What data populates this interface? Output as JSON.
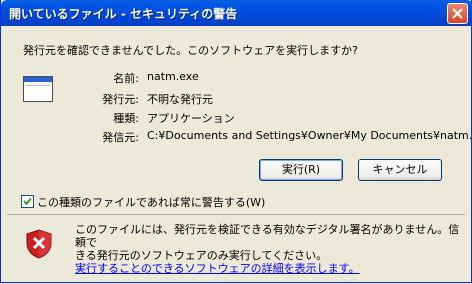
{
  "window": {
    "title": "開いているファイル - セキュリティの警告"
  },
  "dialog": {
    "prompt": "発行元を確認できませんでした。このソフトウェアを実行しますか?",
    "fields": [
      {
        "label": "名前:",
        "value": "natm.exe"
      },
      {
        "label": "発行元:",
        "value": "不明な発行元"
      },
      {
        "label": "種類:",
        "value": "アプリケーション"
      },
      {
        "label": "発信元:",
        "value": "C:¥Documents and Settings¥Owner¥My Documents¥natm.."
      }
    ],
    "run_button": "実行(R)",
    "cancel_button": "キャンセル",
    "checkbox_label": "この種類のファイルであれば常に警告する(W)",
    "checkbox_checked": true,
    "info_line1": "このファイルには、発行元を検証できる有効なデジタル署名がありません。信頼で",
    "info_line2": "きる発行元のソフトウェアのみ実行してください。",
    "info_link": "実行することのできるソフトウェアの詳細を表示します。"
  },
  "icons": {
    "close": "close-icon",
    "application": "application-icon",
    "warning": "security-warning-shield-icon"
  },
  "colors": {
    "titlebar": "#0055e5",
    "close_button": "#d9442a",
    "link": "#0000ff",
    "shield": "#cc1f1f"
  }
}
